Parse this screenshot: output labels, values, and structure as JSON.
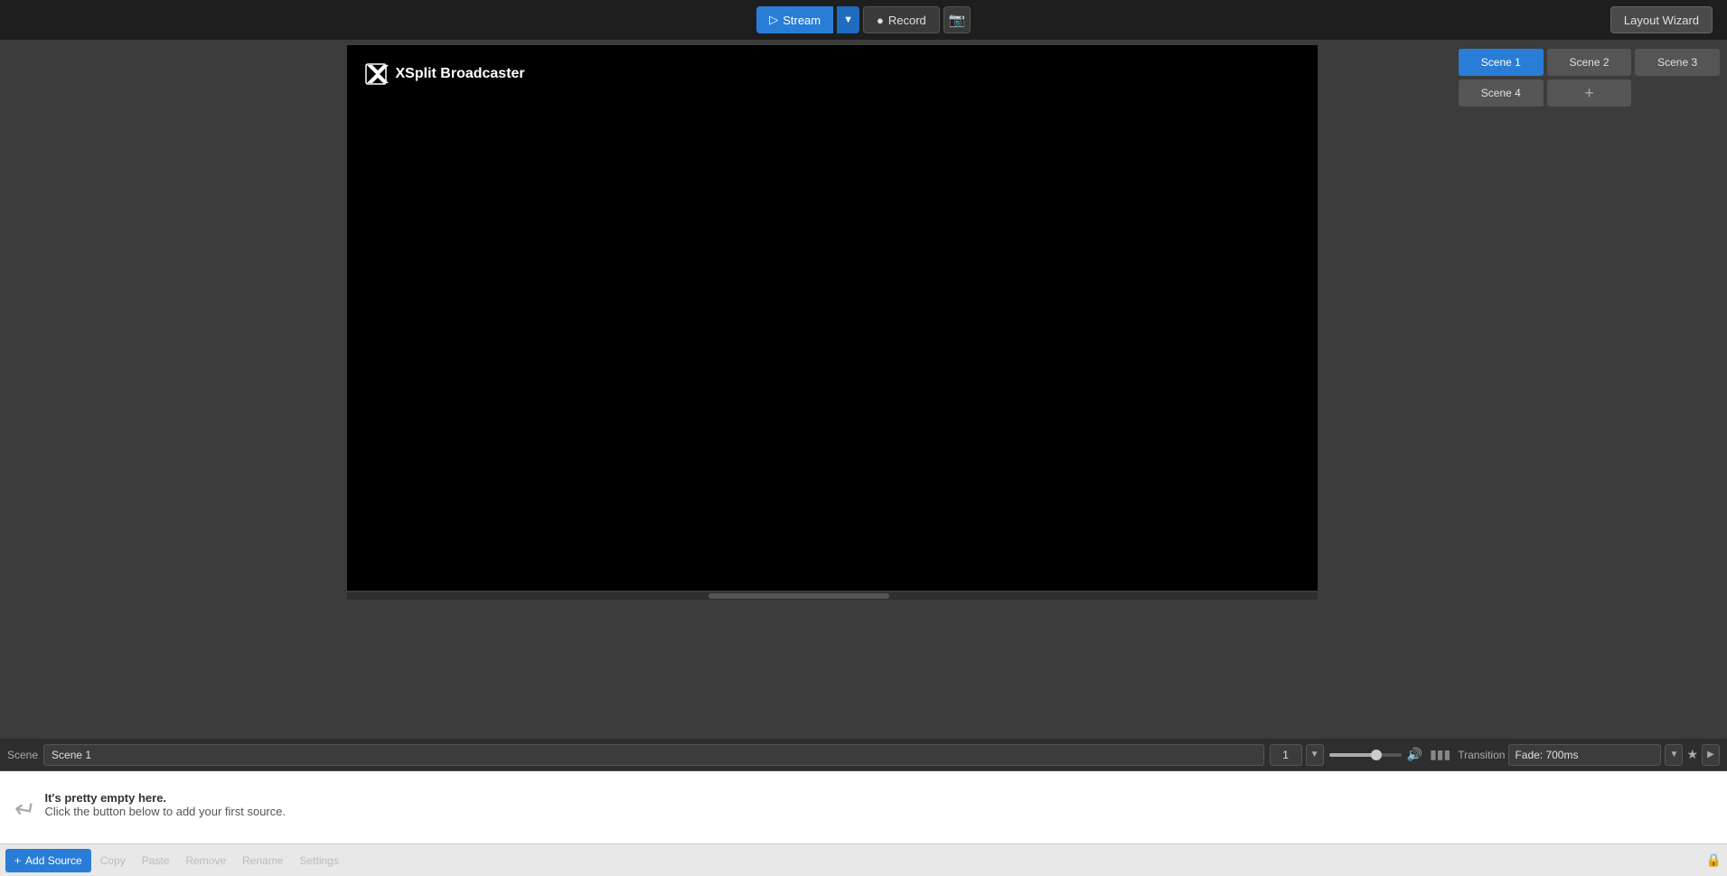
{
  "topbar": {
    "stream_label": "Stream",
    "record_label": "Record",
    "layout_wizard_label": "Layout Wizard"
  },
  "preview": {
    "logo_text": "XSplit Broadcaster"
  },
  "scene_row": {
    "label": "Scene",
    "name": "Scene 1",
    "num": "1",
    "transition_label": "Transition",
    "transition_value": "Fade: 700ms"
  },
  "scenes": [
    {
      "label": "Scene 1",
      "active": true
    },
    {
      "label": "Scene 2",
      "active": false
    },
    {
      "label": "Scene 3",
      "active": false
    },
    {
      "label": "Scene 4",
      "active": false
    }
  ],
  "sources": {
    "empty_hint_line1": "It's pretty empty here.",
    "empty_hint_line2": "Click the button below to add your first source."
  },
  "toolbar": {
    "add_source_label": "Add Source",
    "copy_label": "Copy",
    "paste_label": "Paste",
    "remove_label": "Remove",
    "rename_label": "Rename",
    "settings_label": "Settings"
  }
}
